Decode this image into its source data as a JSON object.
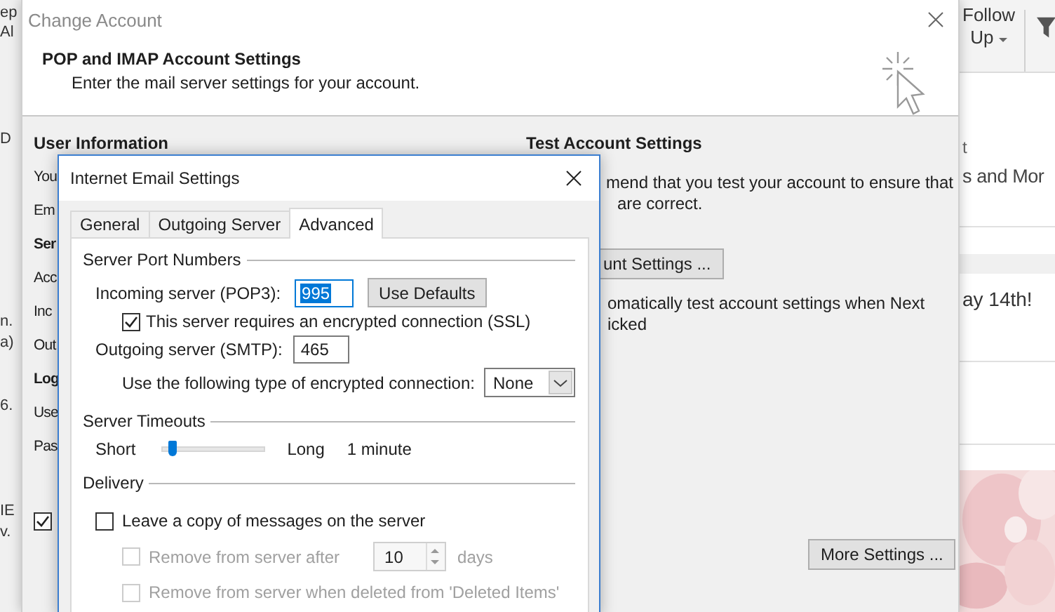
{
  "background_app": {
    "left_fragments": [
      "ep",
      "Al",
      "D",
      "n.",
      "a)",
      "6.",
      "IE",
      "v."
    ],
    "ribbon": {
      "follow_up": [
        "Follow",
        "Up"
      ]
    },
    "list": {
      "fragment": "t",
      "heading": "s and Mor",
      "line": "ay 14th!"
    }
  },
  "change_account": {
    "title": "Change Account",
    "header_title": "POP and IMAP Account Settings",
    "header_subtitle": "Enter the mail server settings for your account.",
    "left_sections": [
      {
        "heading": "User Information",
        "labels": [
          "You",
          "Em"
        ]
      },
      {
        "heading": "Ser",
        "labels": [
          "Acc",
          "Inc",
          "Out"
        ]
      },
      {
        "heading": "Log",
        "labels": [
          "Use",
          "Pas"
        ]
      }
    ],
    "remember_checkbox": {
      "checked": true
    },
    "test_heading": "Test Account Settings",
    "test_text": [
      "mend that you test your account to ensure that",
      "are correct."
    ],
    "test_button": "unt Settings ...",
    "auto_test_text": [
      "omatically test account settings when Next",
      "icked"
    ],
    "more_settings_button": "More Settings ..."
  },
  "internet_email_settings": {
    "title": "Internet Email Settings",
    "tabs": [
      {
        "label": "General",
        "selected": false
      },
      {
        "label": "Outgoing Server",
        "selected": false
      },
      {
        "label": "Advanced",
        "selected": true
      }
    ],
    "server_ports": {
      "heading": "Server Port Numbers",
      "incoming": {
        "label": "Incoming server (POP3):",
        "value": "995",
        "text_selected": true
      },
      "use_defaults_button": "Use Defaults",
      "ssl": {
        "label": "This server requires an encrypted connection (SSL)",
        "checked": true
      },
      "outgoing": {
        "label": "Outgoing server (SMTP):",
        "value": "465"
      },
      "encryption": {
        "label": "Use the following type of encrypted connection:",
        "value": "None"
      }
    },
    "timeouts": {
      "heading": "Server Timeouts",
      "min_label": "Short",
      "max_label": "Long",
      "level": 0.1,
      "reading": "1 minute"
    },
    "delivery": {
      "heading": "Delivery",
      "options": [
        {
          "label": "Leave a copy of messages on the server",
          "checked": false,
          "disabled": false,
          "children": [
            {
              "kind": "spin",
              "label": "Remove from server after",
              "checked": false,
              "disabled": true,
              "value": "10",
              "unit": "days"
            },
            {
              "kind": "checkbox",
              "label": "Remove from server when deleted from 'Deleted Items'",
              "checked": false,
              "disabled": true
            }
          ]
        }
      ]
    }
  }
}
